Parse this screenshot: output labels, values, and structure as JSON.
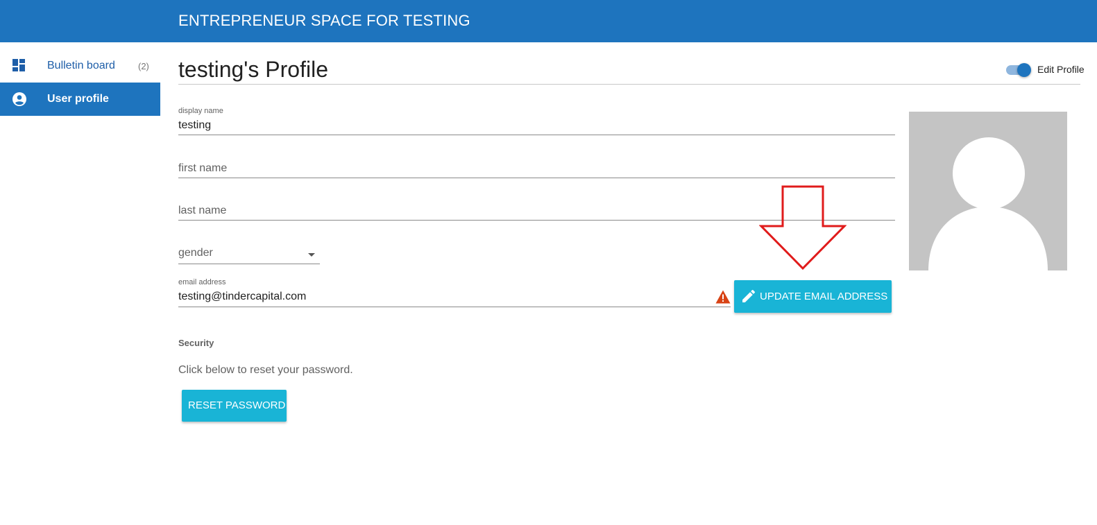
{
  "app": {
    "title": "ENTREPRENEUR SPACE FOR TESTING"
  },
  "sidebar": {
    "items": [
      {
        "label": "Bulletin board",
        "count": "(2)",
        "icon": "dashboard-icon",
        "active": false
      },
      {
        "label": "User profile",
        "count": "",
        "icon": "account-circle-icon",
        "active": true
      }
    ]
  },
  "profile": {
    "title": "testing's Profile",
    "edit_toggle_label": "Edit Profile",
    "edit_toggle_on": true,
    "display_name": {
      "label": "display name",
      "value": "testing"
    },
    "first_name": {
      "placeholder": "first name",
      "value": ""
    },
    "last_name": {
      "placeholder": "last name",
      "value": ""
    },
    "gender": {
      "placeholder": "gender",
      "value": ""
    },
    "email": {
      "label": "email address",
      "value": "testing@tindercapital.com",
      "status_icon": "warning-icon"
    },
    "update_email_button": "UPDATE EMAIL ADDRESS",
    "avatar_icon": "default-avatar"
  },
  "security": {
    "heading": "Security",
    "help_text": "Click below to reset your password.",
    "reset_button": "RESET PASSWORD"
  },
  "colors": {
    "primary": "#1e74be",
    "accent_button": "#19b4d6",
    "warning": "#d84315",
    "annotation": "#e01b1b"
  }
}
